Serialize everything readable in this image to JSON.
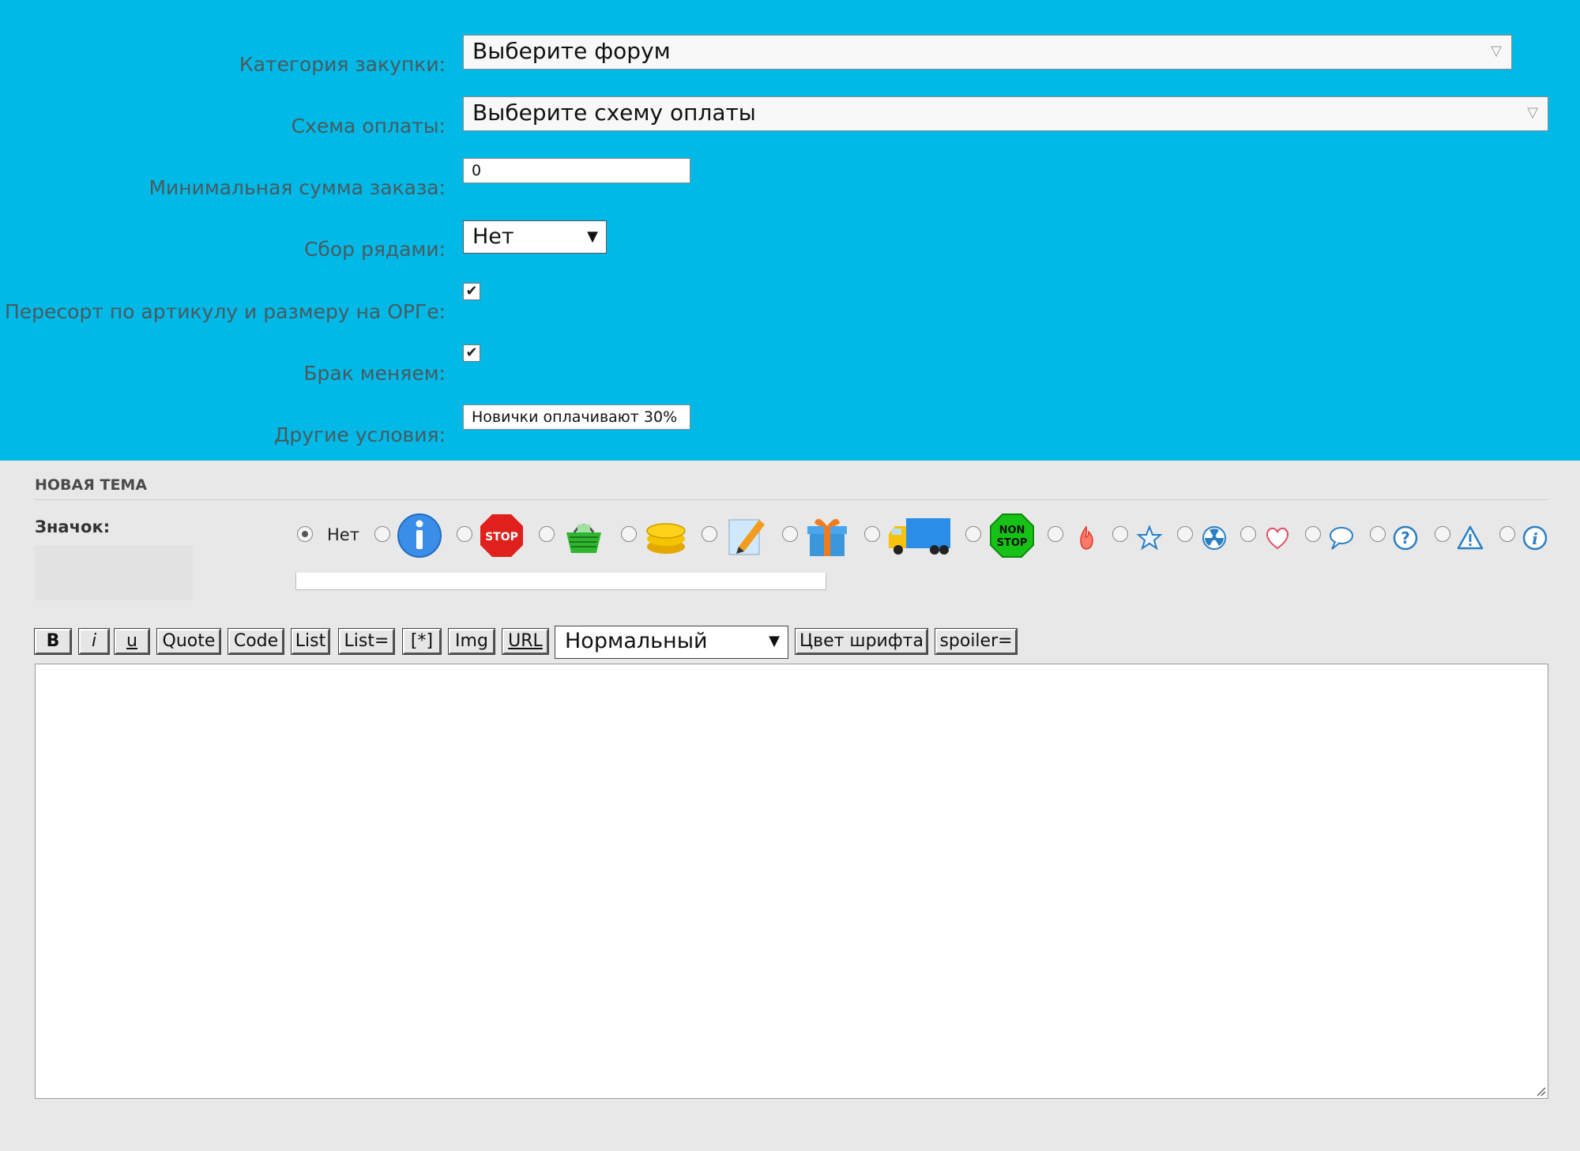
{
  "form": {
    "category": {
      "label": "Категория закупки:",
      "value": "Выберите форум"
    },
    "payment": {
      "label": "Схема оплаты:",
      "value": "Выберите схему оплаты"
    },
    "min_sum": {
      "label": "Минимальная сумма заказа:",
      "value": "0"
    },
    "rows": {
      "label": "Сбор рядами:",
      "value": "Нет"
    },
    "resort": {
      "label": "Пересорт по артикулу и размеру на ОРГе:",
      "checked": true
    },
    "defect": {
      "label": "Брак меняем:",
      "checked": true
    },
    "other": {
      "label": "Другие условия:",
      "value": "Новички оплачивают 30%"
    }
  },
  "topic": {
    "section_title": "НОВАЯ ТЕМА",
    "icon_label": "Значок:",
    "none_label": "Нет",
    "icons": [
      "info-icon",
      "stop-sign-icon",
      "basket-icon",
      "coins-icon",
      "pencil-icon",
      "gift-icon",
      "truck-icon",
      "non-stop-icon",
      "fire-icon",
      "star-icon",
      "radioactive-icon",
      "heart-icon",
      "speech-bubble-icon",
      "question-icon",
      "warning-icon",
      "info-small-icon"
    ]
  },
  "toolbar": {
    "bold": "B",
    "italic": "i",
    "underline": "u",
    "quote": "Quote",
    "code": "Code",
    "list": "List",
    "list_eq": "List=",
    "star": "[*]",
    "img": "Img",
    "url": "URL",
    "size": "Нормальный",
    "color": "Цвет шрифта",
    "spoiler": "spoiler="
  },
  "colors": {
    "top_bg": "#00b9e6",
    "page_bg": "#e8e8e8"
  }
}
